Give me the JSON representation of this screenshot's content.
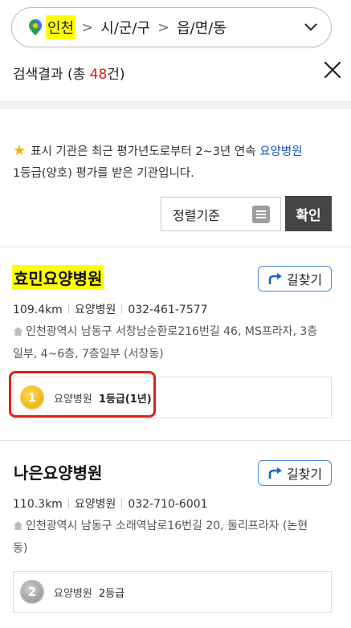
{
  "region_bar": {
    "city": "인천",
    "district": "시/군/구",
    "town": "읍/면/동"
  },
  "results": {
    "prefix": "검색결과 (총 ",
    "count": "48",
    "suffix": "건)"
  },
  "notice": {
    "part1": "표시 기관은 최근 평가년도로부터 2~3년 연속 ",
    "highlight": "요양병원",
    "part2": "1등급(양호) 평가를 받은 기관입니다."
  },
  "sort": {
    "label": "정렬기준",
    "confirm": "확인"
  },
  "hospitals": [
    {
      "name": "효민요양병원",
      "directions": "길찾기",
      "distance": "109.4km",
      "type": "요양병원",
      "phone": "032-461-7577",
      "address": "인천광역시 남동구 서창남순환로216번길 46, MS프라자, 3층일부, 4~6층, 7층일부 (서창동)",
      "grade_type": "요양병원",
      "grade_value": "1등급(1년)",
      "medal": "1"
    },
    {
      "name": "나은요양병원",
      "directions": "길찾기",
      "distance": "110.3km",
      "type": "요양병원",
      "phone": "032-710-6001",
      "address": "인천광역시 남동구 소래역남로16번길 20, 둘리프라자 (논현동)",
      "grade_type": "요양병원",
      "grade_value": "2등급",
      "medal": "2"
    }
  ],
  "colors": {
    "highlight": "#ffff00",
    "count_red": "#d32020",
    "link_blue": "#1a56c4",
    "confirm_bg": "#444444",
    "annotation_red": "#e0201c"
  },
  "icons": {
    "pin": "location-pin-icon",
    "dropdown": "chevron-down-icon",
    "close": "close-icon",
    "star": "star-icon",
    "sort": "list-icon",
    "directions": "turn-arrow-icon",
    "address": "house-icon",
    "medal": "medal-icon"
  }
}
